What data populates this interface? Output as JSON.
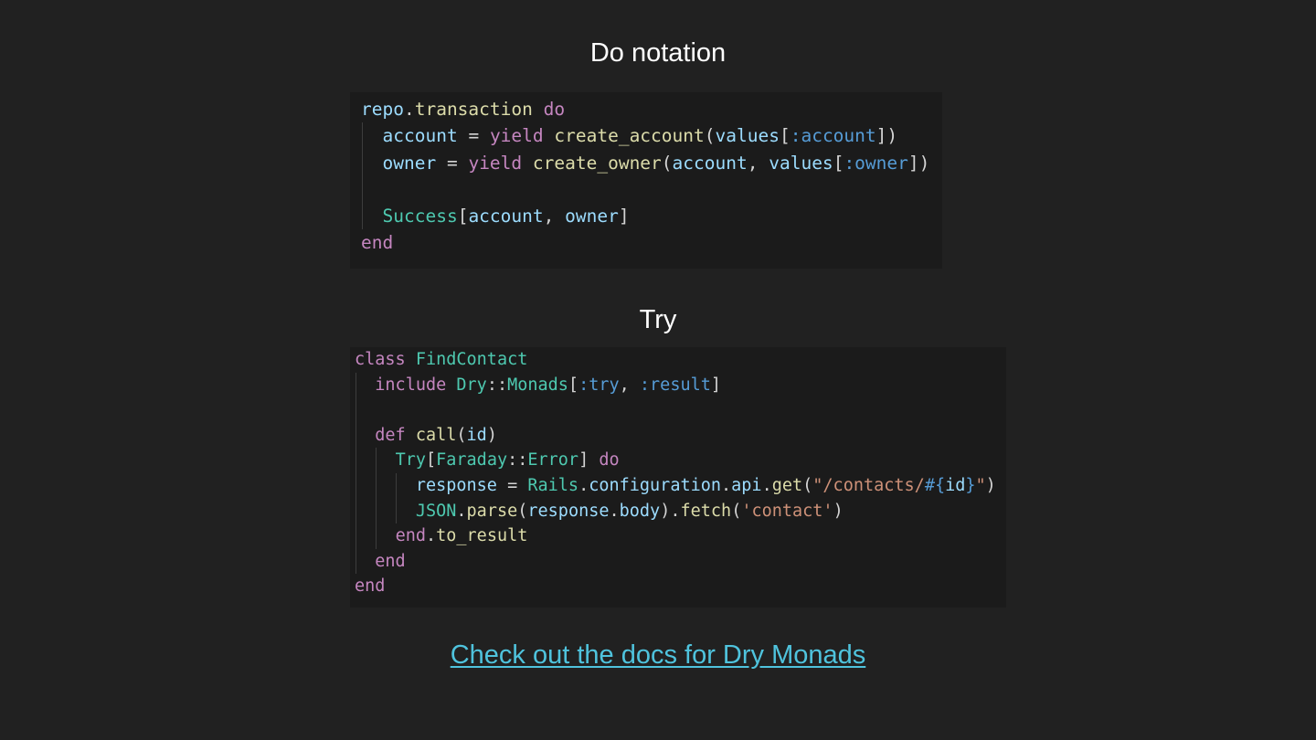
{
  "headings": {
    "do_notation": "Do notation",
    "try": "Try"
  },
  "code_blocks": {
    "do_notation": {
      "language": "ruby",
      "lines": [
        "repo.transaction do",
        "  account = yield create_account(values[:account])",
        "  owner = yield create_owner(account, values[:owner])",
        "",
        "  Success[account, owner]",
        "end"
      ]
    },
    "try": {
      "language": "ruby",
      "lines": [
        "class FindContact",
        "  include Dry::Monads[:try, :result]",
        "",
        "  def call(id)",
        "    Try[Faraday::Error] do",
        "      response = Rails.configuration.api.get(\"/contacts/#{id}\")",
        "      JSON.parse(response.body).fetch('contact')",
        "    end.to_result",
        "  end",
        "end"
      ]
    }
  },
  "link": {
    "label": "Check out the docs for Dry Monads"
  },
  "colors": {
    "background": "#212121",
    "code_background": "#1b1b1b",
    "keyword": "#c586c0",
    "function": "#dcdcaa",
    "variable": "#9cdcfe",
    "type": "#4ec9b0",
    "symbol": "#569cd6",
    "string": "#ce9178",
    "link": "#4fc3dd"
  }
}
